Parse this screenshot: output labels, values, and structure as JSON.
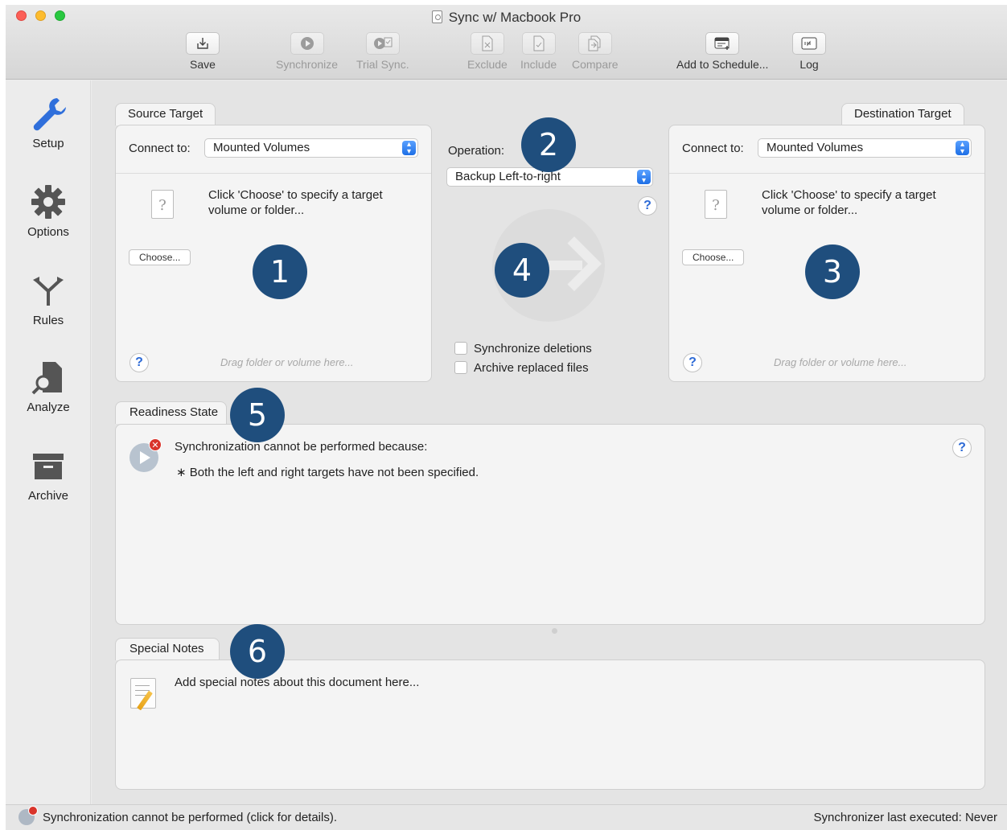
{
  "window": {
    "title": "Sync w/ Macbook Pro"
  },
  "toolbar": {
    "save": "Save",
    "synchronize": "Synchronize",
    "trial_sync": "Trial Sync.",
    "exclude": "Exclude",
    "include": "Include",
    "compare": "Compare",
    "add_to_schedule": "Add to Schedule...",
    "log": "Log"
  },
  "sidebar": {
    "items": [
      {
        "label": "Setup",
        "icon": "wrench-icon",
        "color": "#2f6fdb"
      },
      {
        "label": "Options",
        "icon": "gear-icon"
      },
      {
        "label": "Rules",
        "icon": "branch-icon"
      },
      {
        "label": "Analyze",
        "icon": "analyze-icon"
      },
      {
        "label": "Archive",
        "icon": "archive-icon"
      }
    ]
  },
  "source": {
    "tab": "Source Target",
    "connect_label": "Connect to:",
    "connect_value": "Mounted Volumes",
    "hint": "Click 'Choose' to specify a target volume or folder...",
    "choose": "Choose...",
    "drag": "Drag folder or volume here...",
    "help": "?"
  },
  "destination": {
    "tab": "Destination Target",
    "connect_label": "Connect to:",
    "connect_value": "Mounted Volumes",
    "hint": "Click 'Choose' to specify a target volume or folder...",
    "choose": "Choose...",
    "drag": "Drag folder or volume here...",
    "help": "?"
  },
  "operation": {
    "label": "Operation:",
    "value": "Backup Left-to-right",
    "help": "?",
    "sync_deletions": "Synchronize deletions",
    "archive_replaced": "Archive replaced files"
  },
  "badges": {
    "b1": "1",
    "b2": "2",
    "b3": "3",
    "b4": "4",
    "b5": "5",
    "b6": "6",
    "color": "#1f4e7d"
  },
  "readiness": {
    "tab": "Readiness State",
    "message": "Synchronization cannot be performed because:",
    "detail": "∗ Both the left and right targets have not been specified.",
    "help": "?",
    "error_mark": "✕"
  },
  "notes": {
    "tab": "Special Notes",
    "placeholder": "Add special notes about this document here..."
  },
  "statusbar": {
    "left": "Synchronization cannot be performed (click for details).",
    "right": "Synchronizer last executed:  Never"
  }
}
